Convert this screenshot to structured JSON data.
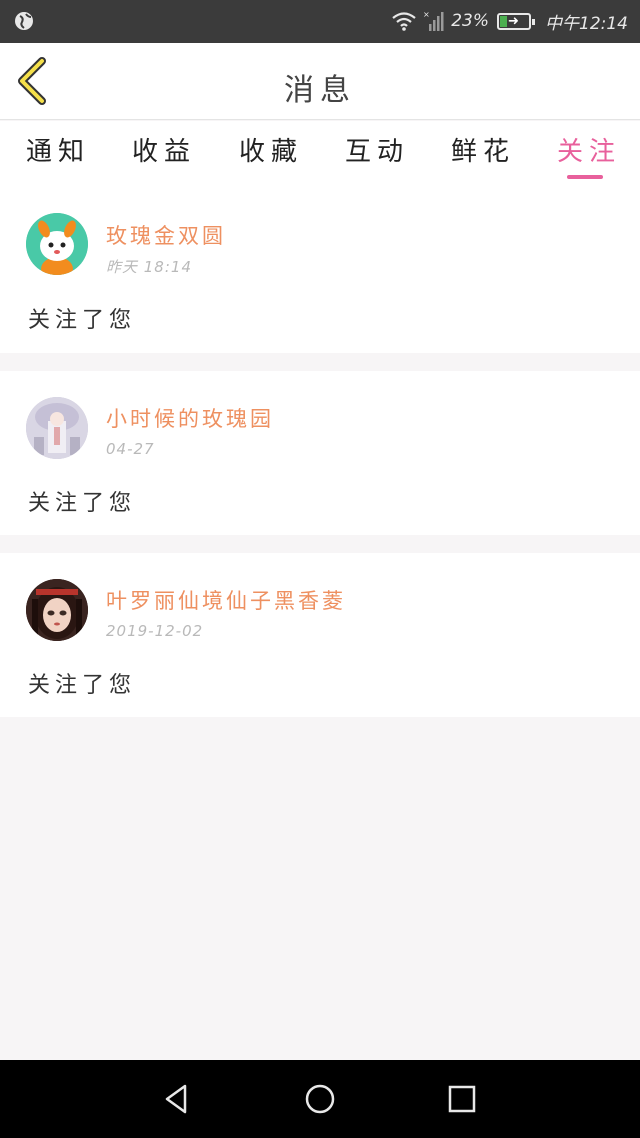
{
  "status_bar": {
    "battery_percent": "23%",
    "time": "中午12:14",
    "icons": [
      "globe-icon",
      "wifi-icon",
      "signal-icon",
      "battery-icon"
    ]
  },
  "header": {
    "title": "消息",
    "back_icon": "chevron-left-icon"
  },
  "tabs": [
    {
      "label": "通知"
    },
    {
      "label": "收益"
    },
    {
      "label": "收藏"
    },
    {
      "label": "互动"
    },
    {
      "label": "鲜花"
    },
    {
      "label": "关注"
    }
  ],
  "active_tab": "关注",
  "colors": {
    "accent": "#e8609c",
    "username": "#ee9060",
    "timestamp": "#b9b9b9",
    "background": "#f7f5f6"
  },
  "follows": [
    {
      "user": "玫瑰金双圆",
      "time": "昨天 18:14",
      "message": "关注了您",
      "avatar": "cartoon-mascot-avatar"
    },
    {
      "user": "小时候的玫瑰园",
      "time": "04-27",
      "message": "关注了您",
      "avatar": "photo-avatar"
    },
    {
      "user": "叶罗丽仙境仙子黑香菱",
      "time": "2019-12-02",
      "message": "关注了您",
      "avatar": "doll-avatar"
    }
  ],
  "nav": [
    "back-triangle-icon",
    "home-circle-icon",
    "recents-square-icon"
  ]
}
